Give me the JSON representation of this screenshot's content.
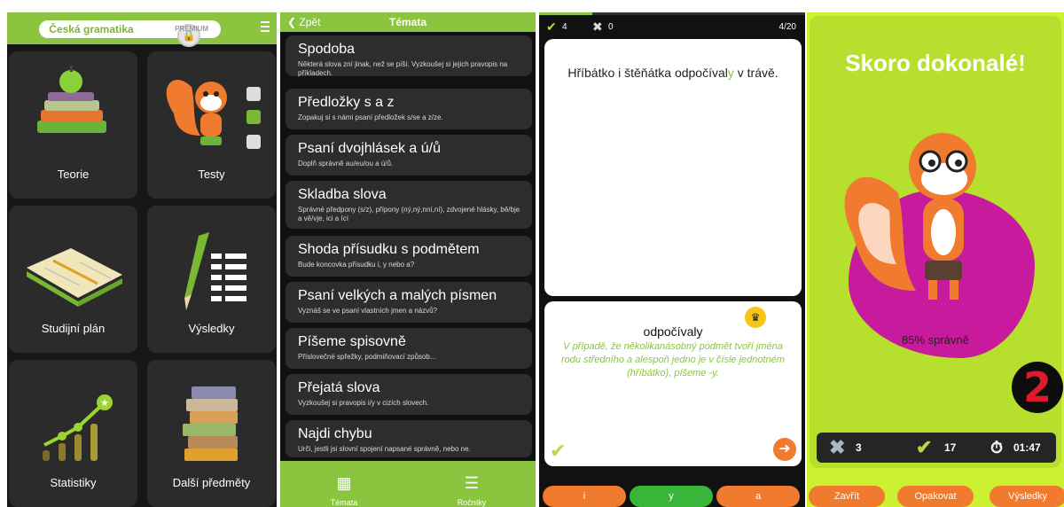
{
  "home": {
    "brand": "Česká gramatika",
    "premium": "PREMIUM",
    "tiles": [
      {
        "label": "Teorie",
        "icon": "books-apple-icon"
      },
      {
        "label": "Testy",
        "icon": "squirrel-checklist-icon"
      },
      {
        "label": "Studijní plán",
        "icon": "notebook-icon"
      },
      {
        "label": "Výsledky",
        "icon": "pencil-list-icon"
      },
      {
        "label": "Statistiky",
        "icon": "chart-growth-icon"
      },
      {
        "label": "Další předměty",
        "icon": "book-stack-icon"
      }
    ]
  },
  "topics": {
    "back_label": "Zpět",
    "title": "Témata",
    "items": [
      {
        "title": "Spodoba",
        "desc": "Některá slova zní jinak, než se píší. Vyzkoušej si jejich pravopis na příkladech."
      },
      {
        "title": "Předložky s a z",
        "desc": "Zopakuj si s námi psaní předložek s/se a z/ze."
      },
      {
        "title": "Psaní dvojhlásek a ú/ů",
        "desc": "Doplň správně au/eu/ou a ú/ů."
      },
      {
        "title": "Skladba slova",
        "desc": "Správné předpony (s/z), přípony (ný,ný,nní,ní), zdvojené hlásky, bě/bje a vě/vje, ici a ící"
      },
      {
        "title": "Shoda přísudku s podmětem",
        "desc": "Bude koncovka přísudku i, y nebo a?"
      },
      {
        "title": "Psaní velkých a malých písmen",
        "desc": "Vyznáš se ve psaní vlastních jmen a názvů?"
      },
      {
        "title": "Píšeme spisovně",
        "desc": "Příslovečné spřežky, podmiňovací způsob..."
      },
      {
        "title": "Přejatá slova",
        "desc": "Vyzkoušej si pravopis i/y v cizích slovech."
      },
      {
        "title": "Najdi chybu",
        "desc": "Urči, jestli jsi slovní spojení napsané správně, nebo ne."
      }
    ],
    "tabs": [
      {
        "label": "Témata",
        "icon": "grid-icon"
      },
      {
        "label": "Ročníky",
        "icon": "list-icon"
      }
    ]
  },
  "quiz": {
    "correct_count": "4",
    "wrong_count": "0",
    "progress_text": "4/20",
    "progress_fraction": 0.2,
    "question_before": "Hříbátko i štěňátka odpočíval",
    "question_gap": "y",
    "question_after": " v trávě.",
    "answer_word": "odpočívaly",
    "explanation": "V případě, že několikanásobný podmět tvoří jména rodu středního a alespoň jedno je v čísle jednotném (hříbátko), píšeme -y.",
    "options": [
      "i",
      "y",
      "a"
    ],
    "selected_option": "y",
    "colors": {
      "accent": "#8bc540",
      "orange": "#f07a2e"
    }
  },
  "result": {
    "headline": "Skoro dokonalé!",
    "percent_text": "85% správně",
    "grade": "2",
    "wrong": "3",
    "correct": "17",
    "time": "01:47",
    "buttons": [
      "Zavřít",
      "Opakovat",
      "Výsledky"
    ]
  }
}
